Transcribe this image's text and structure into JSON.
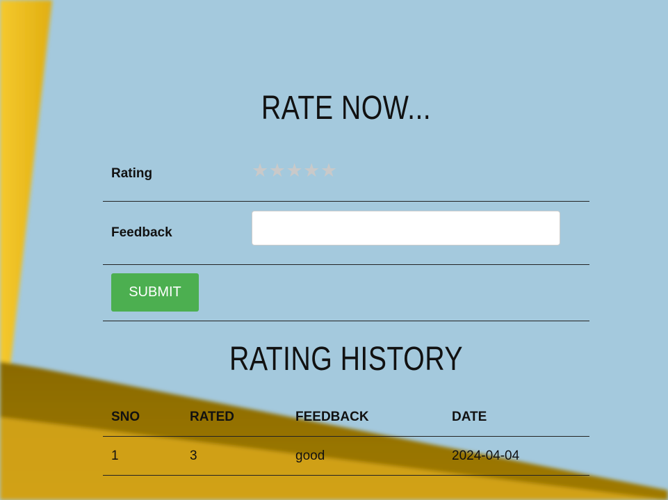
{
  "rate_section": {
    "title": "RATE NOW...",
    "rating_label": "Rating",
    "stars": [
      "★",
      "★",
      "★",
      "★",
      "★"
    ],
    "feedback_label": "Feedback",
    "feedback_value": "",
    "submit_label": "SUBMIT"
  },
  "history_section": {
    "title": "RATING HISTORY",
    "columns": [
      "SNO",
      "RATED",
      "FEEDBACK",
      "DATE"
    ],
    "rows": [
      [
        "1",
        "3",
        "good",
        "2024-04-04"
      ]
    ]
  },
  "colors": {
    "background": "#a4c9dd",
    "yellow_accent": "#f0c419",
    "submit_button": "#4caf50",
    "star_empty": "#c9c9c9"
  }
}
